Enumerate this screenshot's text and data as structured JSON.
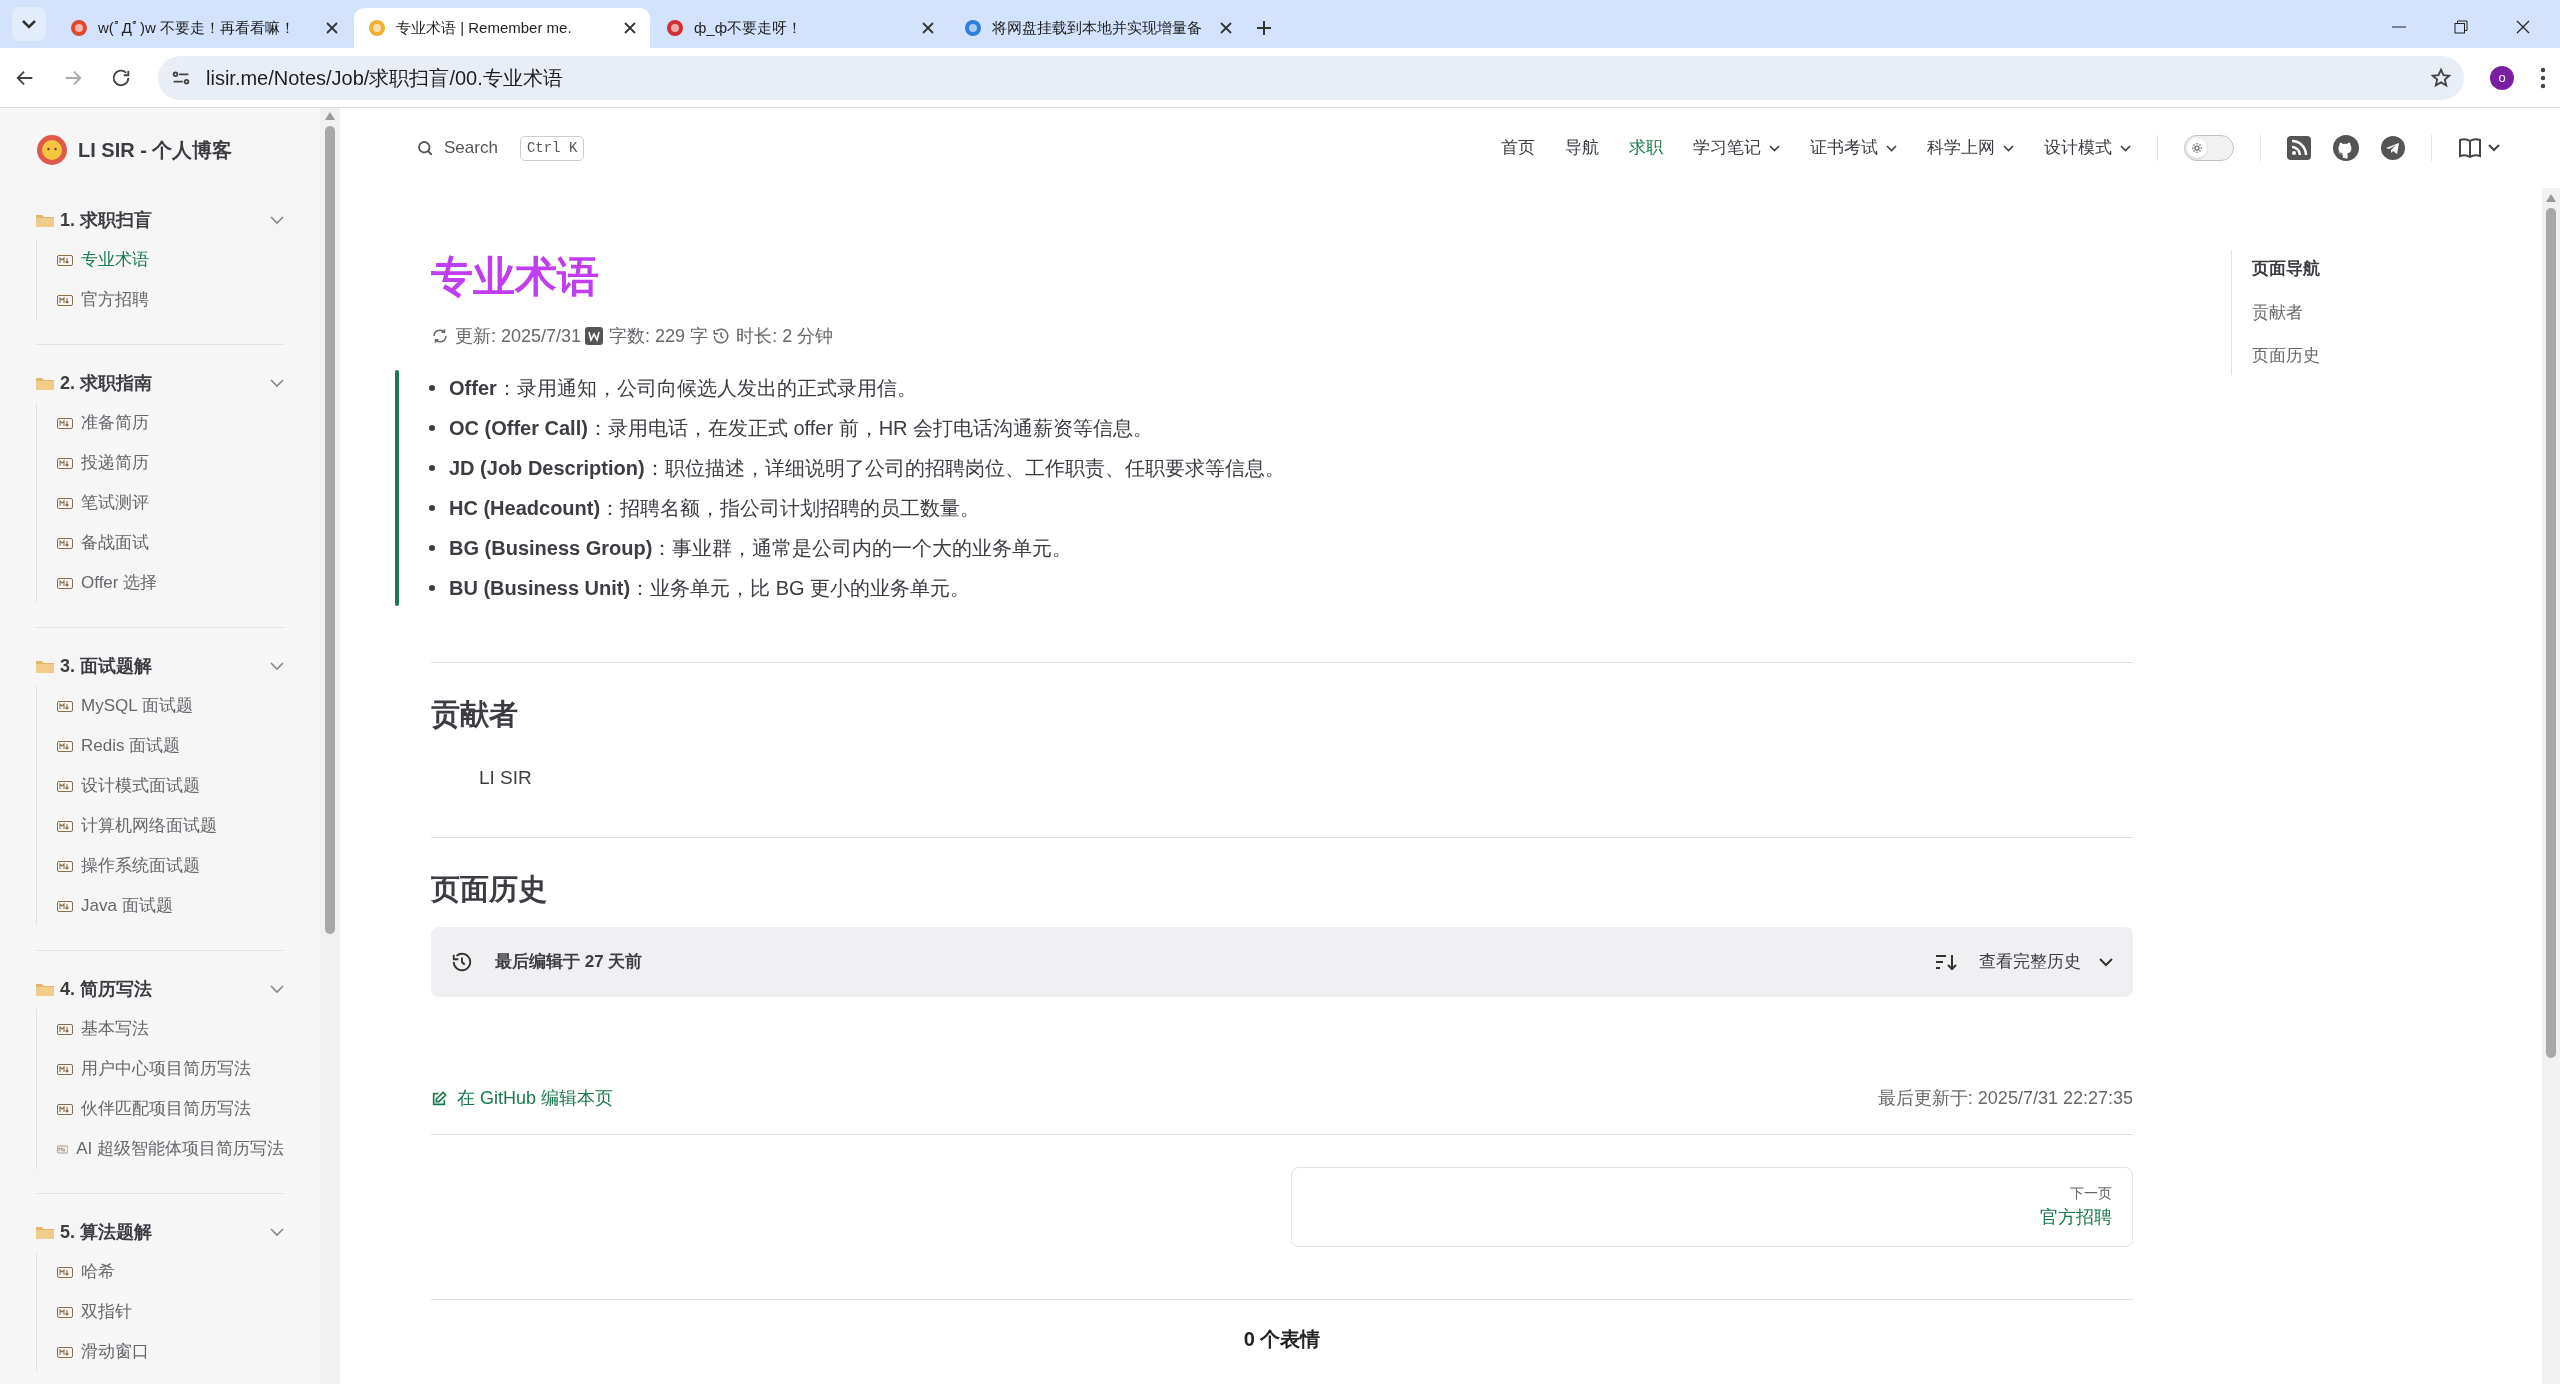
{
  "browser": {
    "tabs": [
      {
        "title": "w(ﾟДﾟ)w 不要走！再看看嘛！",
        "selected": false
      },
      {
        "title": "专业术语 | Remember me.",
        "selected": true
      },
      {
        "title": "ф_ф不要走呀！",
        "selected": false
      },
      {
        "title": "将网盘挂载到本地并实现增量备",
        "selected": false
      }
    ],
    "address": "lisir.me/Notes/Job/求职扫盲/00.专业术语",
    "profile": "o"
  },
  "site": {
    "title": "LI SIR - 个人博客"
  },
  "search": {
    "placeholder": "Search",
    "shortcut": "Ctrl K"
  },
  "nav": [
    {
      "label": "首页",
      "selected": false,
      "dropdown": false
    },
    {
      "label": "导航",
      "selected": false,
      "dropdown": false
    },
    {
      "label": "求职",
      "selected": true,
      "dropdown": false
    },
    {
      "label": "学习笔记",
      "selected": false,
      "dropdown": true
    },
    {
      "label": "证书考试",
      "selected": false,
      "dropdown": true
    },
    {
      "label": "科学上网",
      "selected": false,
      "dropdown": true
    },
    {
      "label": "设计模式",
      "selected": false,
      "dropdown": true
    }
  ],
  "theme_switch": {
    "on": false
  },
  "sidebar": {
    "groups": [
      {
        "title": "1. 求职扫盲",
        "expanded": true,
        "items": [
          {
            "label": "专业术语",
            "selected": true
          },
          {
            "label": "官方招聘",
            "selected": false
          }
        ]
      },
      {
        "title": "2. 求职指南",
        "expanded": true,
        "items": [
          {
            "label": "准备简历",
            "selected": false
          },
          {
            "label": "投递简历",
            "selected": false
          },
          {
            "label": "笔试测评",
            "selected": false
          },
          {
            "label": "备战面试",
            "selected": false
          },
          {
            "label": "Offer 选择",
            "selected": false
          }
        ]
      },
      {
        "title": "3. 面试题解",
        "expanded": true,
        "items": [
          {
            "label": "MySQL 面试题",
            "selected": false
          },
          {
            "label": "Redis 面试题",
            "selected": false
          },
          {
            "label": "设计模式面试题",
            "selected": false
          },
          {
            "label": "计算机网络面试题",
            "selected": false
          },
          {
            "label": "操作系统面试题",
            "selected": false
          },
          {
            "label": "Java 面试题",
            "selected": false
          }
        ]
      },
      {
        "title": "4. 简历写法",
        "expanded": true,
        "items": [
          {
            "label": "基本写法",
            "selected": false
          },
          {
            "label": "用户中心项目简历写法",
            "selected": false
          },
          {
            "label": "伙伴匹配项目简历写法",
            "selected": false
          },
          {
            "label": "AI 超级智能体项目简历写法",
            "selected": false
          }
        ]
      },
      {
        "title": "5. 算法题解",
        "expanded": true,
        "items": [
          {
            "label": "哈希",
            "selected": false
          },
          {
            "label": "双指针",
            "selected": false
          },
          {
            "label": "滑动窗口",
            "selected": false
          }
        ]
      }
    ]
  },
  "article": {
    "title": "专业术语",
    "meta": [
      {
        "kind": "updated",
        "text": "更新: 2025/7/31"
      },
      {
        "kind": "words",
        "text": "字数: 229 字"
      },
      {
        "kind": "duration",
        "text": "时长: 2 分钟"
      }
    ],
    "terms": [
      "**Offer**：录用通知，公司向候选人发出的正式录用信。",
      "**OC (Offer Call)**：录用电话，在发正式 offer 前，HR 会打电话沟通薪资等信息。",
      "**JD (Job Description)**：职位描述，详细说明了公司的招聘岗位、工作职责、任职要求等信息。",
      "**HC (Headcount)**：招聘名额，指公司计划招聘的员工数量。",
      "**BG (Business Group)**：事业群，通常是公司内的一个大的业务单元。",
      "**BU (Business Unit)**：业务单元，比 BG 更小的业务单元。"
    ]
  },
  "contributors": {
    "heading": "贡献者",
    "names": [
      "LI SIR"
    ]
  },
  "history": {
    "heading": "页面历史",
    "last_edit": "最后编辑于 27 天前",
    "view_full": "查看完整历史"
  },
  "footer": {
    "edit_link": "在 GitHub 编辑本页",
    "last_updated": "最后更新于: 2025/7/31 22:27:35",
    "next_label": "下一页",
    "next_title": "官方招聘",
    "reactions": "0 个表情"
  },
  "toc": {
    "title": "页面导航",
    "items": [
      "贡献者",
      "页面历史"
    ]
  }
}
